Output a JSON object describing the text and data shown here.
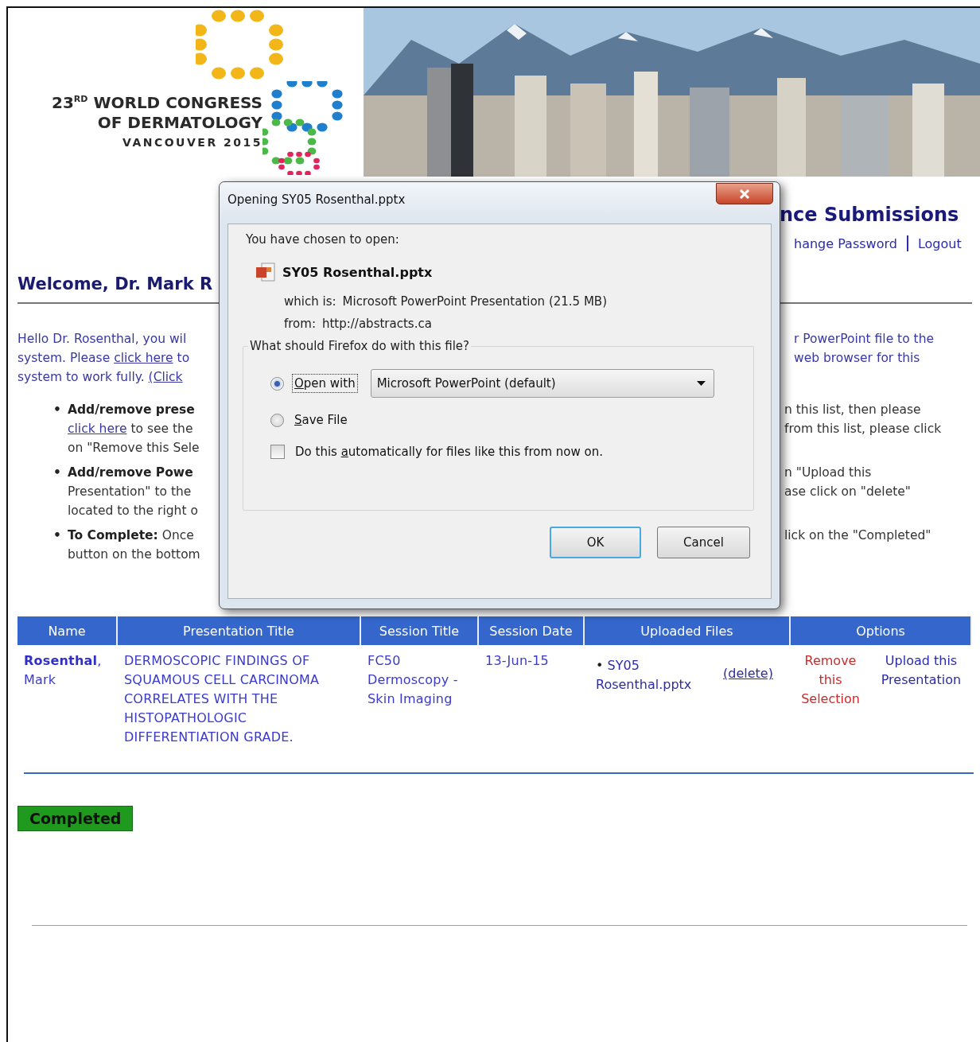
{
  "header": {
    "logo": {
      "lines": [
        "23$^{RD}$ WORLD CONGRESS",
        "OF DERMATOLOGY",
        "VANCOUVER 2015"
      ]
    }
  },
  "page": {
    "title_fragment": "nce Submissions",
    "account_links": [
      {
        "label": "hange Password"
      },
      {
        "label": "Logout"
      }
    ],
    "welcome_fragment": "Welcome, Dr. Mark R",
    "lines": [
      {
        "kind": "para",
        "left": [
          {
            "kind": "plain",
            "text": "Hello Dr. Rosenthal, you wil"
          }
        ],
        "right": "r PowerPoint file to the"
      },
      {
        "kind": "para",
        "left": [
          {
            "kind": "plain",
            "text": "system. Please "
          },
          {
            "kind": "link",
            "text": "click here"
          },
          {
            "kind": "plain",
            "text": " to"
          }
        ],
        "right": "web browser for this"
      },
      {
        "kind": "para",
        "left": [
          {
            "kind": "plain",
            "text": "system to work fully. "
          },
          {
            "kind": "link",
            "text": "(Click"
          }
        ]
      },
      {
        "kind": "item",
        "marker": "•",
        "left": [
          {
            "kind": "bold",
            "text": "Add/remove prese"
          }
        ],
        "right": "n this list, then please"
      },
      {
        "kind": "item",
        "left": [
          {
            "kind": "link",
            "text": "click here"
          },
          {
            "kind": "plain",
            "text": " to see the"
          }
        ],
        "right": "from this list, please click"
      },
      {
        "kind": "item",
        "left": [
          {
            "kind": "plain",
            "text": "on \"Remove this Sele"
          }
        ]
      },
      {
        "kind": "item",
        "marker": "•",
        "left": [
          {
            "kind": "bold",
            "text": "Add/remove Powe"
          }
        ],
        "right": "n \"Upload this"
      },
      {
        "kind": "item",
        "left": [
          {
            "kind": "plain",
            "text": "Presentation\" to the"
          }
        ],
        "right": "ase click on \"delete\""
      },
      {
        "kind": "item",
        "left": [
          {
            "kind": "plain",
            "text": "located to the right o"
          }
        ]
      },
      {
        "kind": "item",
        "marker": "•",
        "left": [
          {
            "kind": "bold",
            "text": "To Complete:"
          },
          {
            "kind": "plain",
            "text": " Once"
          }
        ],
        "right": "lick on the \"Completed\""
      },
      {
        "kind": "item",
        "left": [
          {
            "kind": "plain",
            "text": "button on the bottom"
          }
        ]
      }
    ],
    "table": {
      "columns": [
        "Name",
        "Presentation Title",
        "Session Title",
        "Session Date",
        "Uploaded Files",
        "Options"
      ],
      "rows": [
        {
          "name": "**Rosenthal**, Mark",
          "presentation_title": "DERMOSCOPIC FINDINGS OF SQUAMOUS CELL CARCINOMA CORRELATES WITH THE HISTOPATHOLOGIC DIFFERENTIATION GRADE.",
          "session_title": "FC50 Dermoscopy - Skin Imaging",
          "session_date": "13-Jun-15",
          "files": [
            {
              "marker": "•",
              "name": "SY05 Rosenthal.pptx",
              "action": "(delete)"
            }
          ],
          "options": [
            {
              "kind": "danger",
              "label": "Remove this Selection"
            },
            {
              "kind": "normal",
              "label": "Upload this Presentation"
            }
          ]
        }
      ]
    },
    "complete_button": "Completed"
  },
  "dialog": {
    "title": "Opening SY05 Rosenthal.pptx",
    "prompt": "You have chosen to open:",
    "file_name": "SY05 Rosenthal.pptx",
    "details": [
      {
        "label": "which is:",
        "value": "Microsoft PowerPoint Presentation (21.5 MB)"
      },
      {
        "label": "from:",
        "value": "http://abstracts.ca"
      }
    ],
    "question": "What should Firefox do with this file?",
    "choices": [
      {
        "key": "O",
        "after": "pen with",
        "selected": true,
        "app": "Microsoft PowerPoint (default)"
      },
      {
        "key": "S",
        "after": "ave File",
        "selected": false
      }
    ],
    "remember": {
      "before": "Do this ",
      "key": "a",
      "after": "utomatically for files like this from now on.",
      "checked": false
    },
    "buttons": [
      {
        "label": "OK",
        "default": true
      },
      {
        "label": "Cancel",
        "default": false
      }
    ]
  }
}
